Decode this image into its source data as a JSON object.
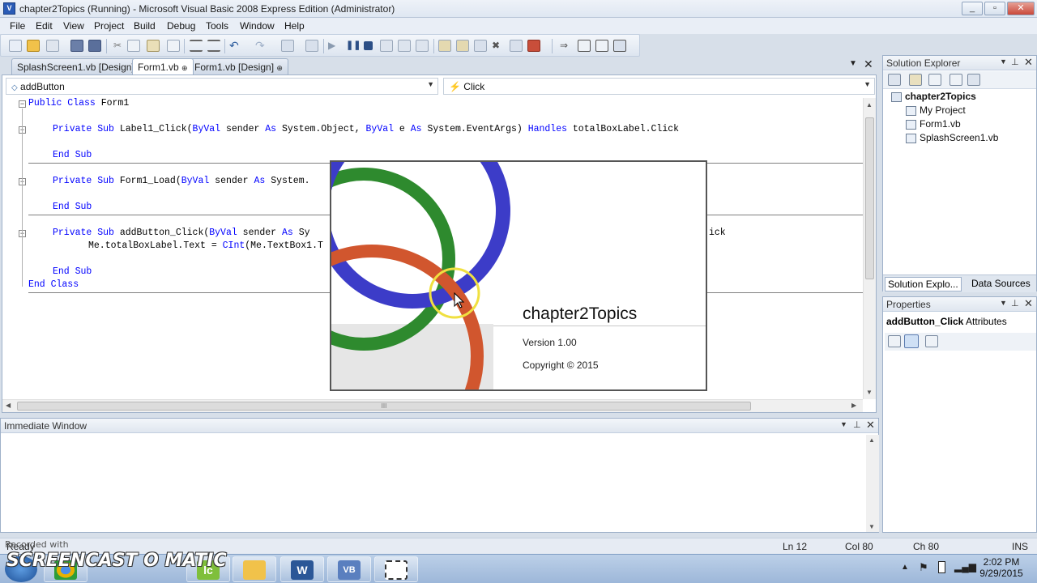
{
  "window": {
    "title": "chapter2Topics (Running) - Microsoft Visual Basic 2008 Express Edition (Administrator)",
    "controls": [
      "_",
      "▫",
      "✕"
    ]
  },
  "menu": [
    "File",
    "Edit",
    "View",
    "Project",
    "Build",
    "Debug",
    "Tools",
    "Window",
    "Help"
  ],
  "tabs": [
    {
      "label": "SplashScreen1.vb [Design]",
      "active": false
    },
    {
      "label": "Form1.vb",
      "active": true
    },
    {
      "label": "Form1.vb [Design]",
      "active": false
    }
  ],
  "editor": {
    "object_combo": "addButton",
    "event_combo": "Click",
    "code_lines": [
      {
        "pre": "",
        "kw": "Public Class",
        "rest": " Form1"
      },
      {
        "pre": "    ",
        "kw": "Private Sub",
        "rest": " Label1_Click(",
        "kw2": "ByVal",
        "rest2": " sender ",
        "kw3": "As",
        "rest3": " System.Object, ",
        "kw4": "ByVal",
        "rest4": " e ",
        "kw5": "As",
        "rest5": " System.EventArgs) ",
        "kw6": "Handles",
        "rest6": " totalBoxLabel.Click"
      },
      {
        "pre": "    ",
        "kw": "End Sub",
        "rest": ""
      },
      {
        "pre": "    ",
        "kw": "Private Sub",
        "rest": " Form1_Load(",
        "kw2": "ByVal",
        "rest2": " sender ",
        "kw3": "As",
        "rest3": " System."
      },
      {
        "pre": "    ",
        "kw": "End Sub",
        "rest": ""
      },
      {
        "pre": "    ",
        "kw": "Private Sub",
        "rest": " addButton_Click(",
        "kw2": "ByVal",
        "rest2": " sender ",
        "kw3": "As",
        "rest3": " Sy"
      },
      {
        "pre": "        ",
        "kw": "",
        "rest": "Me.totalBoxLabel.Text = ",
        "kw2": "CInt",
        "rest2": "(Me.TextBox1.T"
      },
      {
        "pre": "    ",
        "kw": "End Sub",
        "rest": ""
      },
      {
        "pre": "",
        "kw": "End Class",
        "rest": ""
      }
    ],
    "trailing_fragment": "ick",
    "scroll_marker": "III"
  },
  "splash": {
    "title": "chapter2Topics",
    "version": "Version 1.00",
    "copyright": "Copyright ©  2015"
  },
  "immediate": {
    "title": "Immediate Window"
  },
  "solution_explorer": {
    "title": "Solution Explorer",
    "root": "chapter2Topics",
    "items": [
      "My Project",
      "Form1.vb",
      "SplashScreen1.vb"
    ],
    "bottom_tabs": [
      "Solution Explo...",
      "Data Sources"
    ]
  },
  "properties": {
    "title": "Properties",
    "object": "addButton_Click",
    "object_type": "Attributes"
  },
  "status": {
    "ready": "Ready",
    "ln": "Ln 12",
    "col": "Col 80",
    "ch": "Ch 80",
    "mode": "INS"
  },
  "watermark": {
    "line1": "Recorded with",
    "logo": "SCREENCAST O MATIC"
  },
  "taskbar": {
    "time": "2:02 PM",
    "date": "9/29/2015",
    "apps": [
      "chrome",
      "lc",
      "folder",
      "W",
      "VB",
      "screen"
    ],
    "app_glyphs": {
      "lc": "lc",
      "word": "W",
      "vb": "VB"
    }
  },
  "colors": {
    "accent": "#2a5bb6",
    "keyword": "#0000ff",
    "ring_blue": "#3c3cc8",
    "ring_green": "#2e8a2e",
    "ring_orange": "#d1562e",
    "cursor_ring": "#f0e040"
  }
}
